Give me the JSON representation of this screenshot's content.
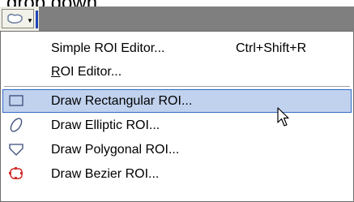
{
  "caption": "drop down.",
  "toolbar": {
    "button_icon": "roi-shape-icon",
    "dropdown_icon": "dropdown-arrow-icon"
  },
  "menu": {
    "items": [
      {
        "label": "Simple ROI Editor...",
        "shortcut": "Ctrl+Shift+R",
        "icon": null
      },
      {
        "label_underlined": "R",
        "label_rest": "OI Editor...",
        "icon": null
      },
      {
        "label": "Draw Rectangular ROI...",
        "icon": "rectangle-icon",
        "highlighted": true
      },
      {
        "label": "Draw Elliptic ROI...",
        "icon": "ellipse-icon"
      },
      {
        "label": "Draw Polygonal ROI...",
        "icon": "polygon-icon"
      },
      {
        "label": "Draw Bezier ROI...",
        "icon": "bezier-icon"
      }
    ]
  },
  "colors": {
    "highlight_bg": "#c1d2ee",
    "highlight_border": "#316ac5",
    "toolbar_accent": "#1e44b8"
  },
  "cursor": "mouse-pointer-icon"
}
